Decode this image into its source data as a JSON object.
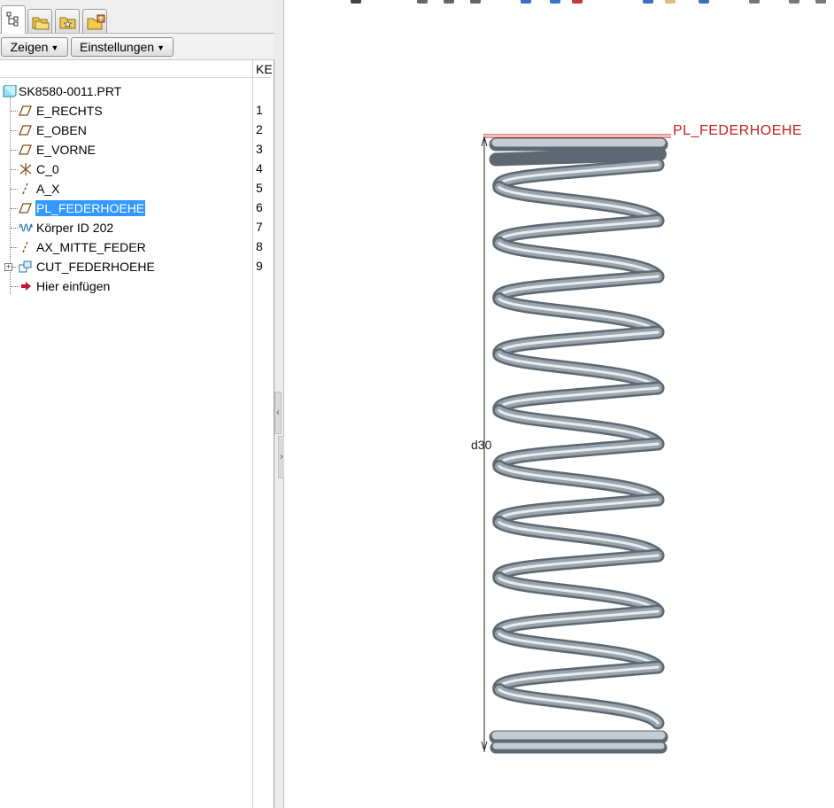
{
  "left_panel": {
    "buttons": {
      "show": "Zeigen",
      "settings": "Einstellungen"
    },
    "column_header": "KE",
    "tree": {
      "root": "SK8580-0011.PRT",
      "items": [
        {
          "label": "E_RECHTS",
          "num": "1",
          "icon": "datum-plane-icon"
        },
        {
          "label": "E_OBEN",
          "num": "2",
          "icon": "datum-plane-icon"
        },
        {
          "label": "E_VORNE",
          "num": "3",
          "icon": "datum-plane-icon"
        },
        {
          "label": "C_0",
          "num": "4",
          "icon": "coordinate-system-icon"
        },
        {
          "label": "A_X",
          "num": "5",
          "icon": "datum-axis-icon"
        },
        {
          "label": "PL_FEDERHOEHE",
          "num": "6",
          "icon": "datum-plane-icon",
          "selected": true
        },
        {
          "label": "Körper ID 202",
          "num": "7",
          "icon": "helical-sweep-icon"
        },
        {
          "label": "AX_MITTE_FEDER",
          "num": "8",
          "icon": "datum-axis-icon"
        },
        {
          "label": "CUT_FEDERHOEHE",
          "num": "9",
          "icon": "cut-feature-icon"
        },
        {
          "label": "Hier einfügen",
          "num": "",
          "icon": "insert-here-arrow-icon"
        }
      ]
    }
  },
  "graphics": {
    "datum_label": "PL_FEDERHOEHE",
    "dimension_label": "d30"
  },
  "colors": {
    "selection": "#3399ff",
    "datum_red": "#c41e1e",
    "spring_steel": "#9aa4ad"
  }
}
